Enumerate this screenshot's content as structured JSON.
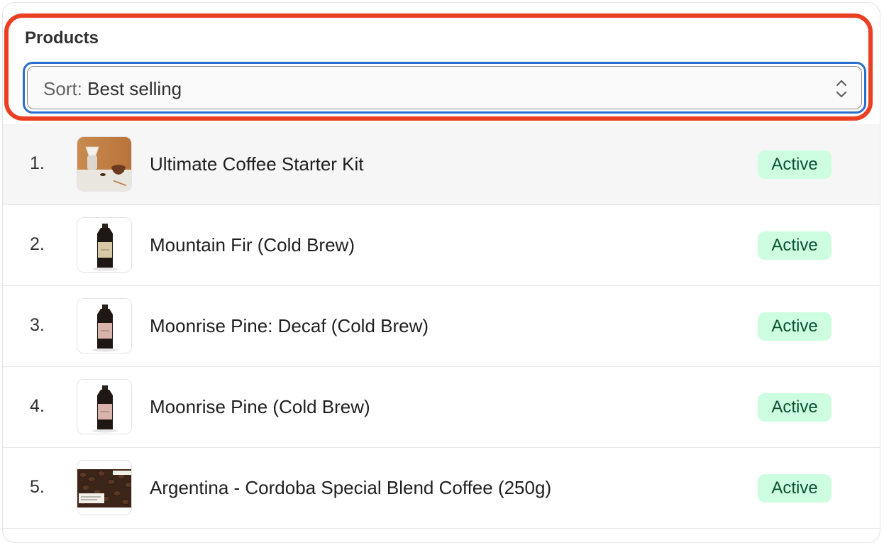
{
  "products_widget": {
    "title": "Products",
    "sort": {
      "prefix": "Sort:",
      "value": "Best selling",
      "icon": "select-chevron-icon"
    },
    "accent_colors": {
      "highlight": "#ea3f23",
      "focus": "#2c6ecb",
      "badge_bg": "#cdfee1",
      "badge_text": "#0c5132"
    },
    "products": [
      {
        "rank": "1.",
        "name": "Ultimate Coffee Starter Kit",
        "status": "Active",
        "thumbnail": "coffee-kit-image"
      },
      {
        "rank": "2.",
        "name": "Mountain Fir (Cold Brew)",
        "status": "Active",
        "thumbnail": "cold-brew-bottle-image"
      },
      {
        "rank": "3.",
        "name": "Moonrise Pine: Decaf (Cold Brew)",
        "status": "Active",
        "thumbnail": "cold-brew-bottle-image"
      },
      {
        "rank": "4.",
        "name": "Moonrise Pine (Cold Brew)",
        "status": "Active",
        "thumbnail": "cold-brew-bottle-image"
      },
      {
        "rank": "5.",
        "name": "Argentina - Cordoba Special Blend Coffee (250g)",
        "status": "Active",
        "thumbnail": "coffee-beans-image"
      }
    ]
  }
}
